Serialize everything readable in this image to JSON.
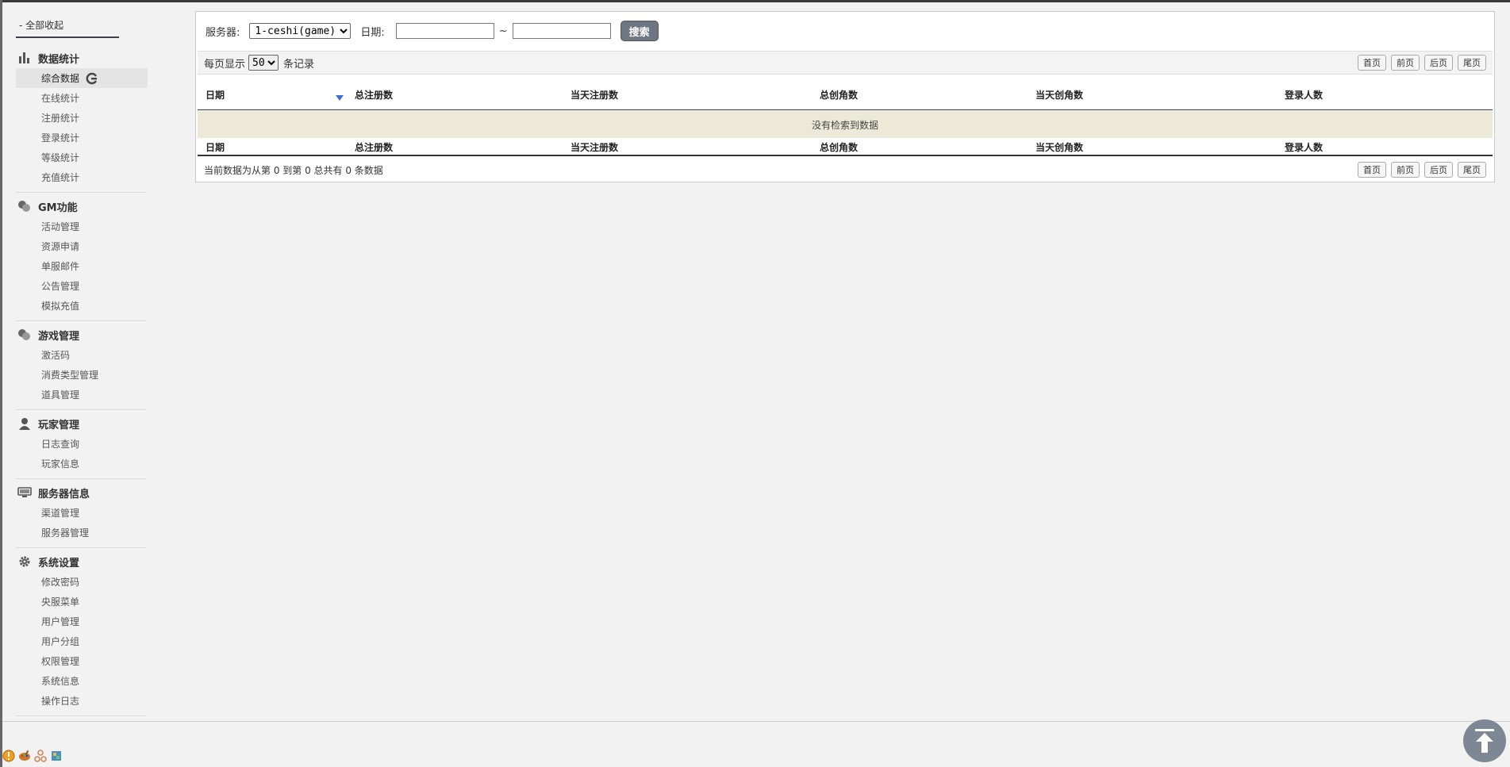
{
  "sidebar": {
    "collapse_all": "- 全部收起",
    "groups": [
      {
        "title": "数据统计",
        "icon": "bar-chart-icon",
        "items": [
          "综合数据",
          "在线统计",
          "注册统计",
          "登录统计",
          "等级统计",
          "充值统计"
        ],
        "active_index": 0
      },
      {
        "title": "GM功能",
        "icon": "toggle-icon",
        "items": [
          "活动管理",
          "资源申请",
          "单服邮件",
          "公告管理",
          "模拟充值"
        ]
      },
      {
        "title": "游戏管理",
        "icon": "toggle-icon",
        "items": [
          "激活码",
          "消费类型管理",
          "道具管理"
        ]
      },
      {
        "title": "玩家管理",
        "icon": "user-icon",
        "items": [
          "日志查询",
          "玩家信息"
        ]
      },
      {
        "title": "服务器信息",
        "icon": "server-icon",
        "items": [
          "渠道管理",
          "服务器管理"
        ]
      },
      {
        "title": "系统设置",
        "icon": "gear-icon",
        "items": [
          "修改密码",
          "央服菜单",
          "用户管理",
          "用户分组",
          "权限管理",
          "系统信息",
          "操作日志"
        ]
      }
    ]
  },
  "search": {
    "server_label": "服务器:",
    "server_value": "1-ceshi(game)",
    "date_label": "日期:",
    "date_from": "",
    "date_to": "",
    "tilde": "~",
    "search_button": "搜索"
  },
  "toolbar": {
    "per_page_prefix": "每页显示",
    "per_page_value": "50",
    "per_page_suffix": "条记录"
  },
  "pager": {
    "first": "首页",
    "prev": "前页",
    "next": "后页",
    "last": "尾页"
  },
  "table": {
    "columns": [
      "日期",
      "总注册数",
      "当天注册数",
      "总创角数",
      "当天创角数",
      "登录人数"
    ],
    "empty_text": "没有检索到数据"
  },
  "info": {
    "summary": "当前数据为从第 0 到第 0 总共有 0 条数据"
  },
  "colors": {
    "search_button": "#6f7683",
    "empty_row": "#ece9d8",
    "sort_arrow": "#3b6fd4"
  }
}
